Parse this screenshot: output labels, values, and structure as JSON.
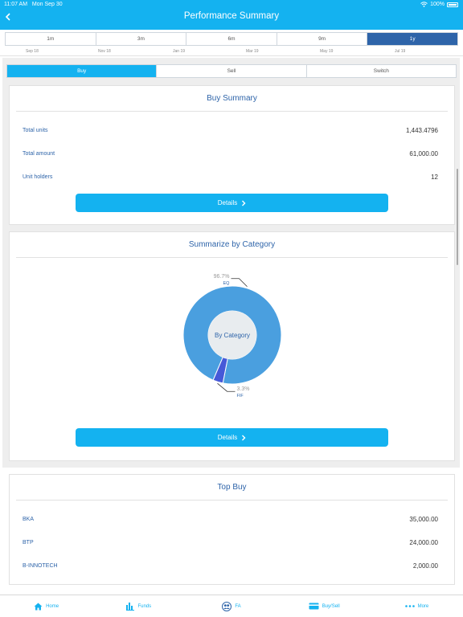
{
  "status_bar": {
    "time": "11:07 AM",
    "date": "Mon Sep 30",
    "battery": "100%",
    "wifi_icon": "wifi-icon",
    "battery_icon": "battery-icon"
  },
  "header": {
    "title": "Performance Summary",
    "back_icon": "chevron-left-icon"
  },
  "period_tabs": [
    {
      "label": "1m",
      "active": false
    },
    {
      "label": "3m",
      "active": false
    },
    {
      "label": "6m",
      "active": false
    },
    {
      "label": "9m",
      "active": false
    },
    {
      "label": "1y",
      "active": true
    }
  ],
  "timeline_labels": [
    "Sep 18",
    "Nov 18",
    "Jan 19",
    "Mar 19",
    "May 19",
    "Jul 19"
  ],
  "segment_tabs": [
    {
      "label": "Buy",
      "active": true
    },
    {
      "label": "Sell",
      "active": false
    },
    {
      "label": "Switch",
      "active": false
    }
  ],
  "buy_summary": {
    "title": "Buy Summary",
    "rows": [
      {
        "label": "Total units",
        "value": "1,443.4796"
      },
      {
        "label": "Total amount",
        "value": "61,000.00"
      },
      {
        "label": "Unit holders",
        "value": "12"
      }
    ],
    "details_label": "Details"
  },
  "category": {
    "title": "Summarize by Category",
    "center_label": "By Category",
    "details_label": "Details",
    "chart_data": {
      "type": "pie",
      "title": "By Category",
      "categories": [
        "EQ",
        "FIF"
      ],
      "values": [
        96.7,
        3.3
      ],
      "value_labels": [
        "96.7%",
        "3.3%"
      ],
      "colors": [
        "#4a9fdf",
        "#4659d8"
      ]
    }
  },
  "top_buy": {
    "title": "Top Buy",
    "rows": [
      {
        "label": "BKA",
        "value": "35,000.00"
      },
      {
        "label": "BTP",
        "value": "24,000.00"
      },
      {
        "label": "B-INNOTECH",
        "value": "2,000.00"
      }
    ]
  },
  "bottom_nav": [
    {
      "label": "Home",
      "icon": "home-icon"
    },
    {
      "label": "Funds",
      "icon": "bar-chart-icon"
    },
    {
      "label": "FA",
      "icon": "people-icon"
    },
    {
      "label": "Buy/Sell",
      "icon": "card-icon"
    },
    {
      "label": "More",
      "icon": "more-dots-icon"
    }
  ],
  "colors": {
    "primary": "#14b2f0",
    "accent": "#2e64a9",
    "background": "#eeeeee"
  }
}
